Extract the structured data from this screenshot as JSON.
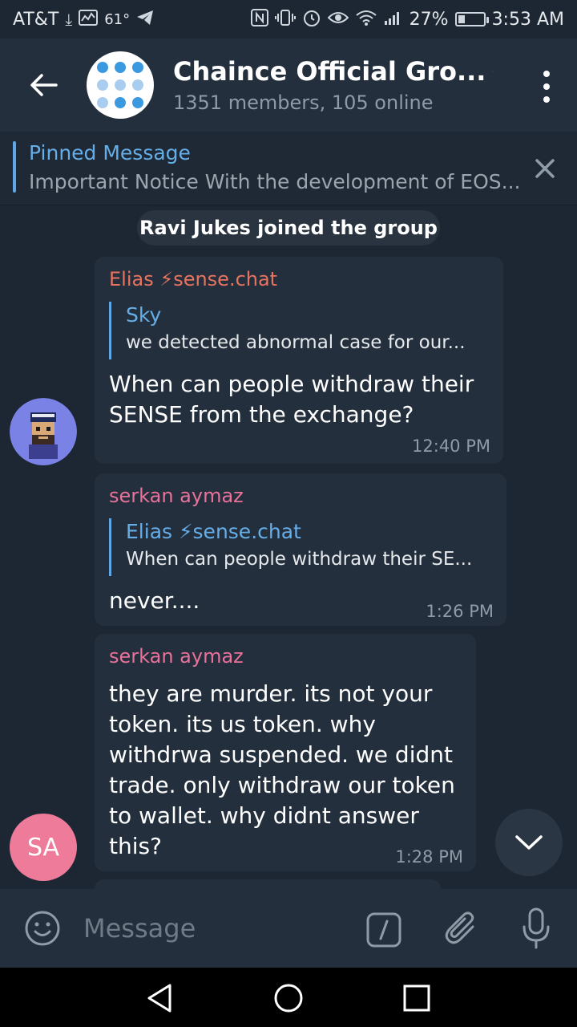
{
  "status_bar": {
    "carrier": "AT&T",
    "temperature": "61°",
    "battery_percent": "27%",
    "battery_level": 0.27,
    "time": "3:53 AM"
  },
  "header": {
    "title": "Chaince Official Gro...",
    "subtitle": "1351 members, 105 online",
    "muted_icon": "muted-speaker-icon"
  },
  "pinned": {
    "title": "Pinned Message",
    "text": "Important Notice With the development of EOS..."
  },
  "chat": {
    "service_message": "Ravi Jukes joined the group",
    "messages": [
      {
        "sender": "Elias ⚡sense.chat",
        "sender_color": "#e8735f",
        "reply_name": "Sky",
        "reply_text": "we detected abnormal case for our...",
        "lines": [
          "When can people withdraw their",
          "SENSE from the exchange?"
        ],
        "time": "12:40 PM"
      },
      {
        "sender": "serkan aymaz",
        "sender_color": "#e8729a",
        "reply_name": "Elias ⚡sense.chat",
        "reply_text": "When can people withdraw their SE...",
        "lines": [
          "never...."
        ],
        "time": "1:26 PM"
      },
      {
        "sender": "serkan aymaz",
        "sender_color": "#e8729a",
        "lines": [
          "they are murder. its not your",
          "token. its us token. why",
          "withdrwa suspended. we didnt",
          "trade. only withdraw our token",
          "to wallet. why didnt answer",
          "this?"
        ],
        "time": "1:28 PM"
      }
    ],
    "sa_initials": "SA"
  },
  "input": {
    "placeholder": "Message"
  },
  "colors": {
    "bg": "#1d2733",
    "header": "#242f3d",
    "bubble": "#242f3d",
    "accent": "#65aee8"
  }
}
